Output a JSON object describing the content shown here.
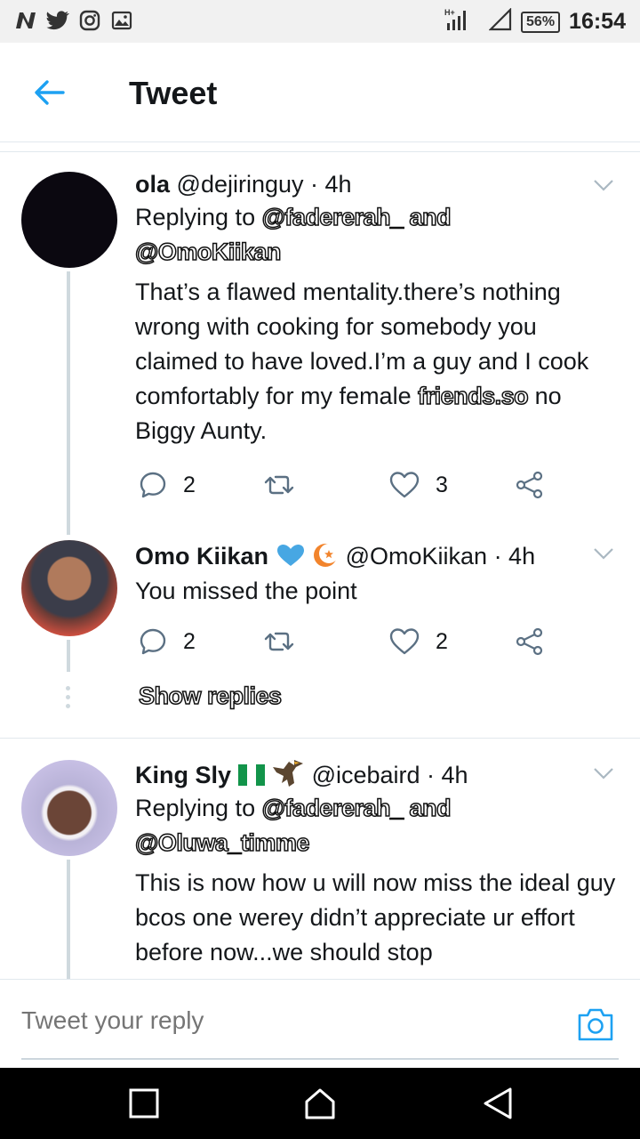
{
  "status_bar": {
    "left_icons": [
      "n-app-icon",
      "twitter-bird-icon",
      "instagram-icon",
      "image-icon"
    ],
    "battery": "56%",
    "time": "16:54"
  },
  "header": {
    "title": "Tweet"
  },
  "tweets": [
    {
      "name": "ola",
      "handle": "@dejiringuy",
      "time": "· 4h",
      "reply_prefix": "Replying to",
      "reply_targets": "@fadererah_ and",
      "reply_targets_line2": "@OmoKiikan",
      "text": "That’s a flawed mentality.there’s nothing wrong with cooking for somebody you claimed to have loved.I’m a guy and I cook comfortably for my female",
      "text_outlined": "friends.so",
      "text_tail": " no Biggy Aunty.",
      "replies": "2",
      "likes": "3"
    },
    {
      "name": "Omo Kiikan",
      "handle": "@OmoKiikan",
      "time": "· 4h",
      "text": "You missed the point",
      "replies": "2",
      "likes": "2",
      "show_replies": "Show replies"
    },
    {
      "name": "King Sly",
      "handle": "@icebaird",
      "time": "· 4h",
      "reply_prefix": "Replying to",
      "reply_targets": "@fadererah_ and",
      "reply_targets_line2": "@Oluwa_timme",
      "text": "This is now how u will now miss the ideal guy bcos one werey didn’t appreciate ur effort before now...we should stop"
    }
  ],
  "reply_bar": {
    "placeholder": "Tweet your reply"
  },
  "colors": {
    "accent": "#1da1f2",
    "text": "#14171a",
    "divider": "#e1e8ed",
    "status_bg": "#f1f1f1",
    "nav_bg": "#000000"
  }
}
